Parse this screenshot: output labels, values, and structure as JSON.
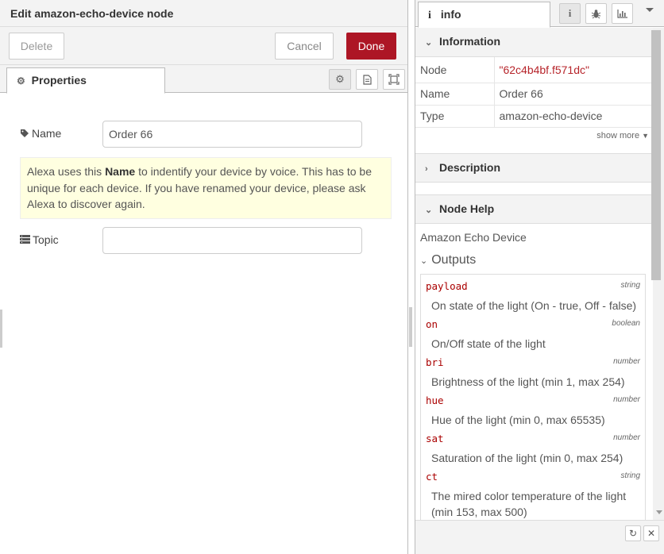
{
  "tray": {
    "title": "Edit amazon-echo-device node",
    "delete_label": "Delete",
    "cancel_label": "Cancel",
    "done_label": "Done",
    "tab_properties": "Properties",
    "name_label": "Name",
    "name_value": "Order 66",
    "tip_pre": "Alexa uses this ",
    "tip_bold": "Name",
    "tip_post": " to indentify your device by voice. This has to be unique for each device. If you have renamed your device, please ask Alexa to discover again.",
    "topic_label": "Topic",
    "topic_value": ""
  },
  "sidebar": {
    "tab_label": "info",
    "information_header": "Information",
    "info_rows": [
      {
        "key": "Node",
        "value": "\"62c4b4bf.f571dc\""
      },
      {
        "key": "Name",
        "value": "Order 66"
      },
      {
        "key": "Type",
        "value": "amazon-echo-device"
      }
    ],
    "show_more": "show more",
    "description_header": "Description",
    "node_help_header": "Node Help",
    "help_title": "Amazon Echo Device",
    "outputs_title": "Outputs",
    "outputs": [
      {
        "name": "payload",
        "type": "string",
        "desc": "On state of the light (On - true, Off - false)"
      },
      {
        "name": "on",
        "type": "boolean",
        "desc": "On/Off state of the light"
      },
      {
        "name": "bri",
        "type": "number",
        "desc": "Brightness of the light (min 1, max 254)"
      },
      {
        "name": "hue",
        "type": "number",
        "desc": "Hue of the light (min 0, max 65535)"
      },
      {
        "name": "sat",
        "type": "number",
        "desc": "Saturation of the light (min 0, max 254)"
      },
      {
        "name": "ct",
        "type": "string",
        "desc": "The mired color temperature of the light (min 153, max 500)"
      }
    ]
  },
  "colors": {
    "done_button": "#ad1625",
    "node_id": "#b7252b",
    "tip_background": "#ffffe0",
    "property_name": "#aa0000"
  },
  "icons": [
    "gear-icon",
    "tag-icon",
    "list-icon",
    "document-icon",
    "frame-icon",
    "info-icon",
    "bug-icon",
    "bar-chart-icon",
    "caret-down-icon",
    "refresh-icon",
    "close-icon"
  ]
}
